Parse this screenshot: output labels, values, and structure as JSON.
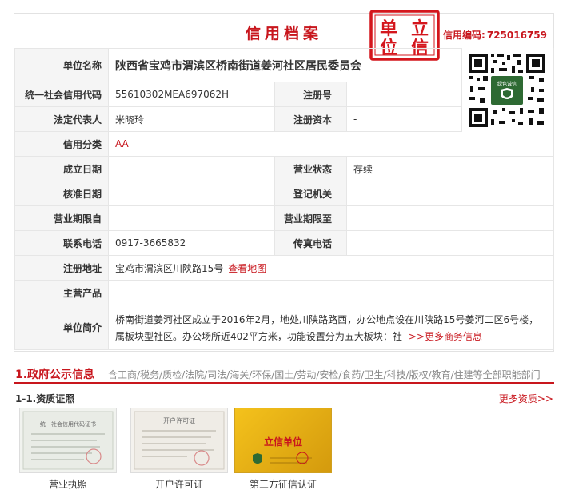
{
  "header": {
    "title": "信用档案",
    "credit_code_label": "信用编码:",
    "credit_code_value": "725016759",
    "seal_chars": [
      "单",
      "立",
      "位",
      "信"
    ]
  },
  "profile": {
    "unit_name_label": "单位名称",
    "unit_name": "陕西省宝鸡市渭滨区桥南街道姜河社区居民委员会",
    "unified_code_label": "统一社会信用代码",
    "unified_code": "55610302MEA697062H",
    "reg_no_label": "注册号",
    "reg_no": "",
    "legal_rep_label": "法定代表人",
    "legal_rep": "米晓玲",
    "reg_capital_label": "注册资本",
    "reg_capital": "-",
    "credit_class_label": "信用分类",
    "credit_class": "AA",
    "founded_label": "成立日期",
    "founded": "",
    "status_label": "营业状态",
    "status": "存续",
    "approved_label": "核准日期",
    "approved": "",
    "reg_authority_label": "登记机关",
    "reg_authority": "",
    "term_start_label": "营业期限自",
    "term_start": "",
    "term_end_label": "营业期限至",
    "term_end": "",
    "phone_label": "联系电话",
    "phone": "0917-3665832",
    "fax_label": "传真电话",
    "fax": "",
    "address_label": "注册地址",
    "address": "宝鸡市渭滨区川陕路15号",
    "map_link": "查看地图",
    "products_label": "主营产品",
    "products": "",
    "intro_label": "单位简介",
    "intro": "桥南街道姜河社区成立于2016年2月，地处川陕路路西，办公地点设在川陕路15号姜河二区6号楼，属板块型社区。办公场所近402平方米，功能设置分为五大板块：社",
    "more_business": ">>更多商务信息"
  },
  "qr": {
    "badge_text": "绿色诚信"
  },
  "gov_section": {
    "title": "1.政府公示信息",
    "categories": "含工商/税务/质检/法院/司法/海关/环保/国土/劳动/安检/食药/卫生/科技/版权/教育/住建等全部职能部门"
  },
  "qualifications": {
    "title": "1-1.资质证照",
    "more": "更多资质>>",
    "items": [
      {
        "caption": "营业执照",
        "thumb_text": "统一社会信用代码证书"
      },
      {
        "caption": "开户许可证",
        "thumb_text": "开户许可证"
      },
      {
        "caption": "第三方征信认证",
        "thumb_text": "立信单位"
      }
    ]
  },
  "colors": {
    "accent": "#c8161d",
    "label_bg": "#f5f5f5",
    "border": "#e6e6e6",
    "gold": "#f4c21c"
  }
}
